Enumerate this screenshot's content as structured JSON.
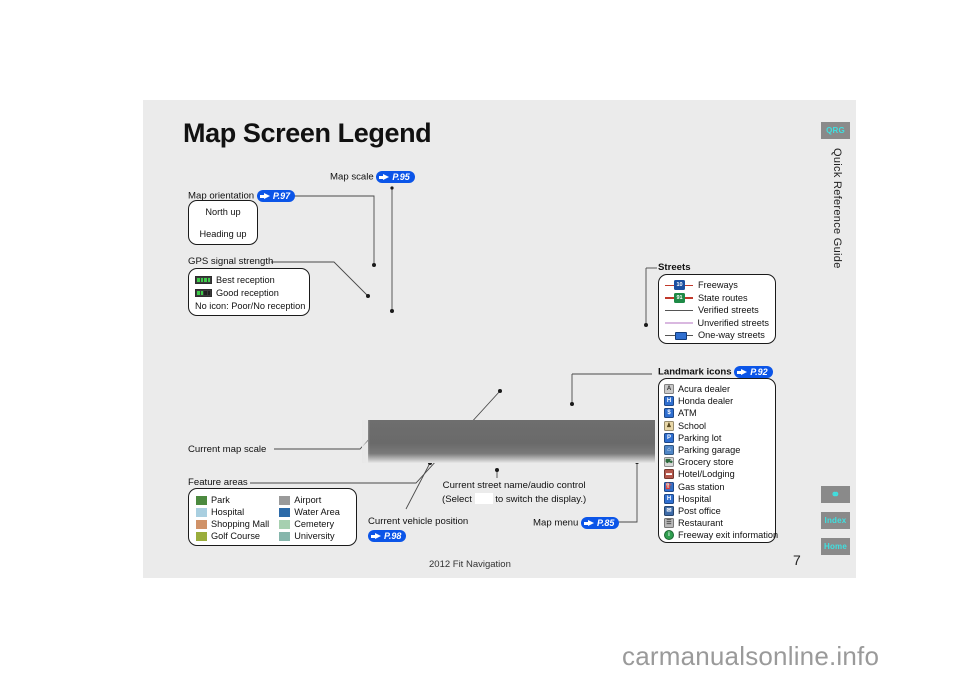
{
  "page": {
    "title": "Map Screen Legend",
    "footer_title": "2012 Fit Navigation",
    "page_number": "7",
    "watermark": "carmanualsonline.info"
  },
  "rail": {
    "tab_qrg": "QRG",
    "tab_route_icon": "route-icon",
    "tab_index": "Index",
    "tab_home": "Home",
    "vertical_label": "Quick Reference Guide"
  },
  "callouts": {
    "map_scale": {
      "label": "Map scale",
      "ref": "P.95"
    },
    "map_orientation": {
      "label": "Map orientation",
      "ref": "P.97"
    },
    "gps_signal": {
      "label": "GPS signal strength"
    },
    "current_map_scale": {
      "label": "Current map scale"
    },
    "feature_areas": {
      "label": "Feature areas"
    },
    "streets": {
      "label": "Streets"
    },
    "landmark_icons": {
      "label": "Landmark icons",
      "ref": "P.92"
    },
    "current_street": {
      "line1": "Current street name/audio control",
      "line2_pre": "(Select",
      "line2_post": "to switch the display.)"
    },
    "current_vehicle": {
      "label": "Current vehicle position",
      "ref": "P.98"
    },
    "map_menu": {
      "label": "Map menu",
      "ref": "P.85"
    }
  },
  "orientation_box": {
    "items": [
      "North up",
      "Heading up"
    ]
  },
  "gps_box": {
    "items": [
      {
        "icon": "gps-best-icon",
        "label": "Best reception"
      },
      {
        "icon": "gps-good-icon",
        "label": "Good reception"
      },
      {
        "icon": "none",
        "label": "No icon: Poor/No reception"
      }
    ]
  },
  "feature_areas_box": {
    "left": [
      {
        "label": "Park",
        "color": "#4c8a3f"
      },
      {
        "label": "Hospital",
        "color": "#a9cfe0"
      },
      {
        "label": "Shopping Mall",
        "color": "#d09268"
      },
      {
        "label": "Golf Course",
        "color": "#9aad3c"
      }
    ],
    "right": [
      {
        "label": "Airport",
        "color": "#9a9a9a"
      },
      {
        "label": "Water Area",
        "color": "#2c6aa8"
      },
      {
        "label": "Cemetery",
        "color": "#a6d0b0"
      },
      {
        "label": "University",
        "color": "#86b6ac"
      }
    ]
  },
  "streets_box": {
    "items": [
      {
        "label": "Freeways",
        "icon": "freeway-shield-icon",
        "line_color": "#c0392b",
        "shield_color": "#1b4fa0",
        "shield_text": "10"
      },
      {
        "label": "State routes",
        "icon": "state-route-shield-icon",
        "line_color": "#c0392b",
        "shield_color": "#1e8a46",
        "shield_text": "91"
      },
      {
        "label": "Verified streets",
        "icon": "solid-line-icon",
        "line_color": "#555555"
      },
      {
        "label": "Unverified streets",
        "icon": "light-line-icon",
        "line_color": "#d9b8e0"
      },
      {
        "label": "One-way streets",
        "icon": "one-way-arrow-icon",
        "line_color": "#555555"
      }
    ]
  },
  "landmark_box": {
    "items": [
      {
        "label": "Acura dealer",
        "icon": "acura-dealer-icon",
        "color": "#c8c8c8",
        "glyph": "A"
      },
      {
        "label": "Honda dealer",
        "icon": "honda-dealer-icon",
        "color": "#2f6fd0",
        "glyph": "H"
      },
      {
        "label": "ATM",
        "icon": "atm-icon",
        "color": "#2f6fd0",
        "glyph": "$"
      },
      {
        "label": "School",
        "icon": "school-icon",
        "color": "#e8d7a8",
        "glyph": "♟"
      },
      {
        "label": "Parking lot",
        "icon": "parking-lot-icon",
        "color": "#2f6fd0",
        "glyph": "P"
      },
      {
        "label": "Parking garage",
        "icon": "parking-garage-icon",
        "color": "#4f86c6",
        "glyph": "⌂"
      },
      {
        "label": "Grocery store",
        "icon": "grocery-store-icon",
        "color": "#d8d8d8",
        "glyph": "⛟"
      },
      {
        "label": "Hotel/Lodging",
        "icon": "hotel-lodging-icon",
        "color": "#b4564a",
        "glyph": "▬"
      },
      {
        "label": "Gas station",
        "icon": "gas-station-icon",
        "color": "#2f6fd0",
        "glyph": "⛽"
      },
      {
        "label": "Hospital",
        "icon": "hospital-icon",
        "color": "#2f6fd0",
        "glyph": "H"
      },
      {
        "label": "Post office",
        "icon": "post-office-icon",
        "color": "#3d6ba8",
        "glyph": "✉"
      },
      {
        "label": "Restaurant",
        "icon": "restaurant-icon",
        "color": "#b9b9b9",
        "glyph": "☰"
      },
      {
        "label": "Freeway exit information",
        "icon": "freeway-exit-icon",
        "color": "#2f9e4f",
        "glyph": "i"
      }
    ]
  }
}
